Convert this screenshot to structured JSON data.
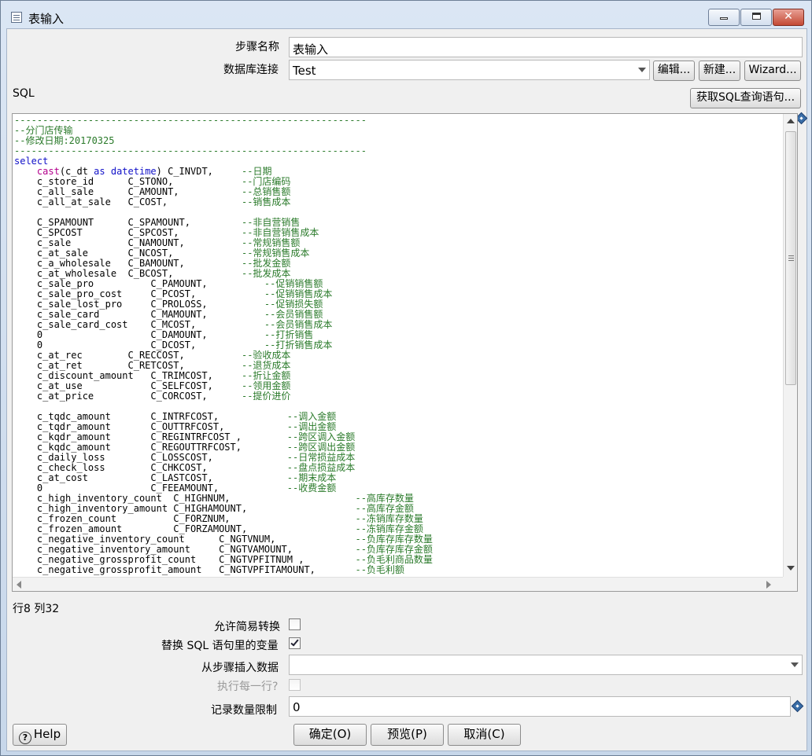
{
  "window": {
    "title": "表输入"
  },
  "form": {
    "step_name_label": "步骤名称",
    "step_name_value": "表输入",
    "db_conn_label": "数据库连接",
    "db_conn_value": "Test",
    "edit_label": "编辑...",
    "new_label": "新建...",
    "wizard_label": "Wizard...",
    "sql_label": "SQL",
    "get_sql_label": "获取SQL查询语句..."
  },
  "sql_lines": [
    [
      "c",
      "--------------------------------------------------------------"
    ],
    [
      "c",
      "--分门店传输"
    ],
    [
      "c",
      "--修改日期:20170325"
    ],
    [
      "c",
      "--------------------------------------------------------------"
    ],
    [
      "k",
      "select"
    ],
    [
      "x",
      "    cast(c_dt as datetime) C_INVDT,     --日期"
    ],
    [
      "x",
      "    c_store_id      C_STONO,            --门店编码"
    ],
    [
      "x",
      "    c_all_sale      C_AMOUNT,           --总销售额"
    ],
    [
      "x",
      "    c_all_at_sale   C_COST,             --销售成本"
    ],
    [
      "x",
      ""
    ],
    [
      "x",
      "    C_SPAMOUNT      C_SPAMOUNT,         --非自营销售"
    ],
    [
      "x",
      "    C_SPCOST        C_SPCOST,           --非自营销售成本"
    ],
    [
      "x",
      "    c_sale          C_NAMOUNT,          --常规销售额"
    ],
    [
      "x",
      "    c_at_sale       C_NCOST,            --常规销售成本"
    ],
    [
      "x",
      "    c_a_wholesale   C_BAMOUNT,          --批发金额"
    ],
    [
      "x",
      "    c_at_wholesale  C_BCOST,            --批发成本"
    ],
    [
      "x",
      "    c_sale_pro          C_PAMOUNT,          --促销销售额"
    ],
    [
      "x",
      "    c_sale_pro_cost     C_PCOST,            --促销销售成本"
    ],
    [
      "x",
      "    c_sale_lost_pro     C_PROLOSS,          --促销损失额"
    ],
    [
      "x",
      "    c_sale_card         C_MAMOUNT,          --会员销售额"
    ],
    [
      "x",
      "    c_sale_card_cost    C_MCOST,            --会员销售成本"
    ],
    [
      "x",
      "    0                   C_DAMOUNT,          --打折销售"
    ],
    [
      "x",
      "    0                   C_DCOST,            --打折销售成本"
    ],
    [
      "x",
      "    c_at_rec        C_RECCOST,          --验收成本"
    ],
    [
      "x",
      "    c_at_ret        C_RETCOST,          --退货成本"
    ],
    [
      "x",
      "    c_discount_amount   C_TRIMCOST,     --折让金额"
    ],
    [
      "x",
      "    c_at_use            C_SELFCOST,     --领用金额"
    ],
    [
      "x",
      "    c_at_price          C_CORCOST,      --提价进价"
    ],
    [
      "x",
      ""
    ],
    [
      "x",
      "    c_tqdc_amount       C_INTRFCOST,            --调入金额"
    ],
    [
      "x",
      "    c_tqdr_amount       C_OUTTRFCOST,           --调出金额"
    ],
    [
      "x",
      "    c_kqdr_amount       C_REGINTRFCOST ,        --跨区调入金额"
    ],
    [
      "x",
      "    c_kqdc_amount       C_REGOUTTRFCOST,        --跨区调出金额"
    ],
    [
      "x",
      "    c_daily_loss        C_LOSSCOST,             --日常损益成本"
    ],
    [
      "x",
      "    c_check_loss        C_CHKCOST,              --盘点损益成本"
    ],
    [
      "x",
      "    c_at_cost           C_LASTCOST,             --期末成本"
    ],
    [
      "x",
      "    0                   C_FEEAMOUNT,            --收费金额"
    ],
    [
      "x",
      "    c_high_inventory_count  C_HIGHNUM,                      --高库存数量"
    ],
    [
      "x",
      "    c_high_inventory_amount C_HIGHAMOUNT,                   --高库存金额"
    ],
    [
      "x",
      "    c_frozen_count          C_FORZNUM,                      --冻销库存数量"
    ],
    [
      "x",
      "    c_frozen_amount         C_FORZAMOUNT,                   --冻销库存金额"
    ],
    [
      "x",
      "    c_negative_inventory_count      C_NGTVNUM,              --负库存库存数量"
    ],
    [
      "x",
      "    c_negative_inventory_amount     C_NGTVAMOUNT,           --负库存库存金额"
    ],
    [
      "x",
      "    c_negative_grossprofit_count    C_NGTVPFITNUM ,         --负毛利商品数量"
    ],
    [
      "x",
      "    c_negative_grossprofit_amount   C_NGTVPFITAMOUNT,       --负毛利额"
    ]
  ],
  "status": {
    "cursor_pos": "行8 列32"
  },
  "options": {
    "lazy_conversion_label": "允许简易转换",
    "lazy_conversion_checked": false,
    "replace_vars_label": "替换 SQL 语句里的变量",
    "replace_vars_checked": true,
    "insert_from_step_label": "从步骤插入数据",
    "insert_from_step_value": "",
    "execute_each_row_label": "执行每一行?",
    "execute_each_row_checked": false,
    "limit_label": "记录数量限制",
    "limit_value": "0"
  },
  "footer": {
    "help_label": "Help",
    "ok_label": "确定(O)",
    "preview_label": "预览(P)",
    "cancel_label": "取消(C)"
  }
}
